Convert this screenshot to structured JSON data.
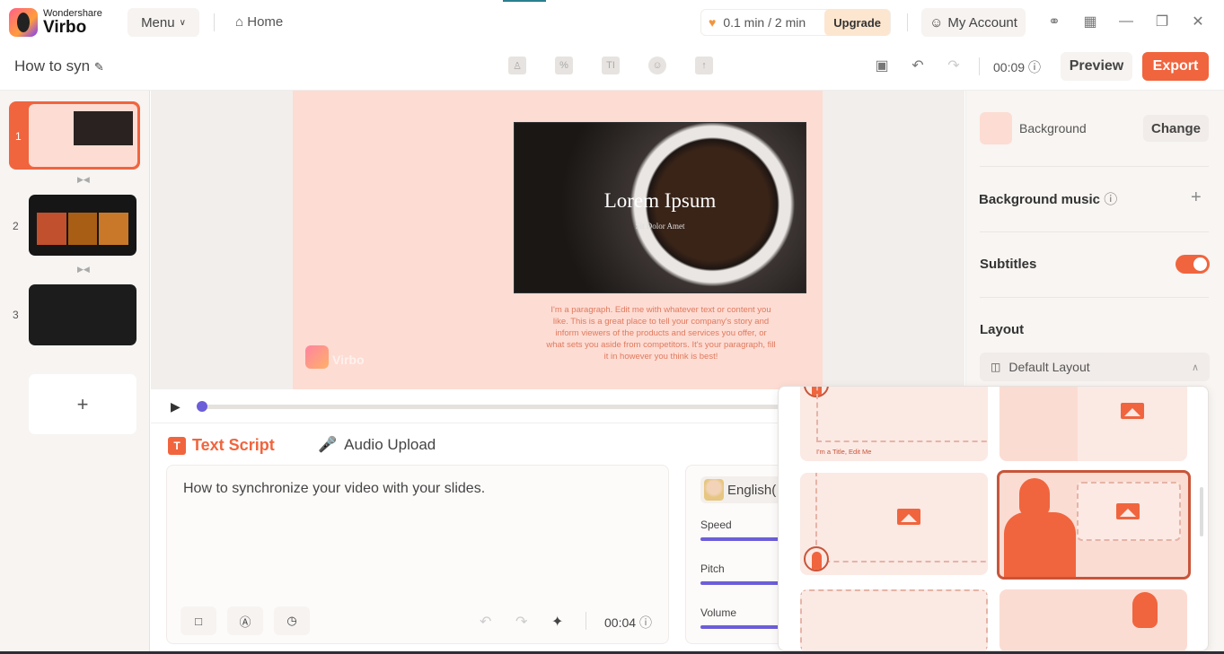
{
  "app": {
    "brand_top": "Wondershare",
    "brand_bottom": "Virbo",
    "menu_label": "Menu",
    "home_label": "Home",
    "quota": "0.1 min / 2 min",
    "upgrade_label": "Upgrade",
    "account_label": "My Account"
  },
  "project": {
    "title": "How to syn",
    "duration": "00:09",
    "preview_label": "Preview",
    "export_label": "Export"
  },
  "slides": [
    {
      "number": "1",
      "selected": true
    },
    {
      "number": "2"
    },
    {
      "number": "3"
    }
  ],
  "slide": {
    "title": "Lorem Ipsum",
    "subtitle": "Sit Dolor Amet",
    "paragraph": "I'm a paragraph. Edit me with whatever text or content you like. This is a great place to tell your company's story and inform viewers of the products and services you offer, or what sets you aside from competitors. It's your paragraph, fill it in however you think is best!",
    "watermark": "Virbo"
  },
  "player": {
    "progress": 0
  },
  "script": {
    "tab_text": "Text Script",
    "tab_audio": "Audio Upload",
    "active_tab": "Text Script",
    "text": "How to synchronize your video with your slides.",
    "duration": "00:04"
  },
  "voice": {
    "language": "English(",
    "speed_label": "Speed",
    "pitch_label": "Pitch",
    "volume_label": "Volume"
  },
  "panel": {
    "background_label": "Background",
    "change_label": "Change",
    "background_color": "#fddcd3",
    "music_label": "Background music",
    "subtitles_label": "Subtitles",
    "subtitles_on": true,
    "layout_label": "Layout",
    "layout_value": "Default Layout"
  },
  "layouts": {
    "card_title": "I'm a Title, Edit Me",
    "selected_index": 3
  },
  "colors": {
    "accent": "#f0653e",
    "slider": "#6c5ed8"
  }
}
